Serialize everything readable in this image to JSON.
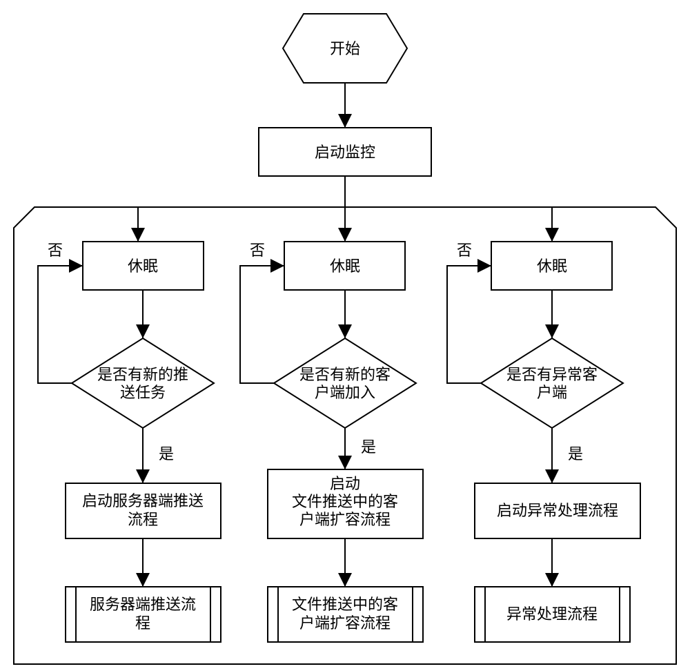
{
  "start": "开始",
  "monitor": "启动监控",
  "sleep": "休眠",
  "no": "否",
  "yes": "是",
  "branches": [
    {
      "decision": [
        "是否有新的推",
        "送任务"
      ],
      "action": [
        "启动服务器端推送",
        "流程"
      ],
      "sub": [
        "服务器端推送流",
        "程"
      ]
    },
    {
      "decision": [
        "是否有新的客",
        "户端加入"
      ],
      "action": [
        "启动",
        "文件推送中的客",
        "户端扩容流程"
      ],
      "sub": [
        "文件推送中的客",
        "户端扩容流程"
      ]
    },
    {
      "decision": [
        "是否有异常客",
        "户端"
      ],
      "action": [
        "启动异常处理流程"
      ],
      "sub": [
        "异常处理流程"
      ]
    }
  ]
}
